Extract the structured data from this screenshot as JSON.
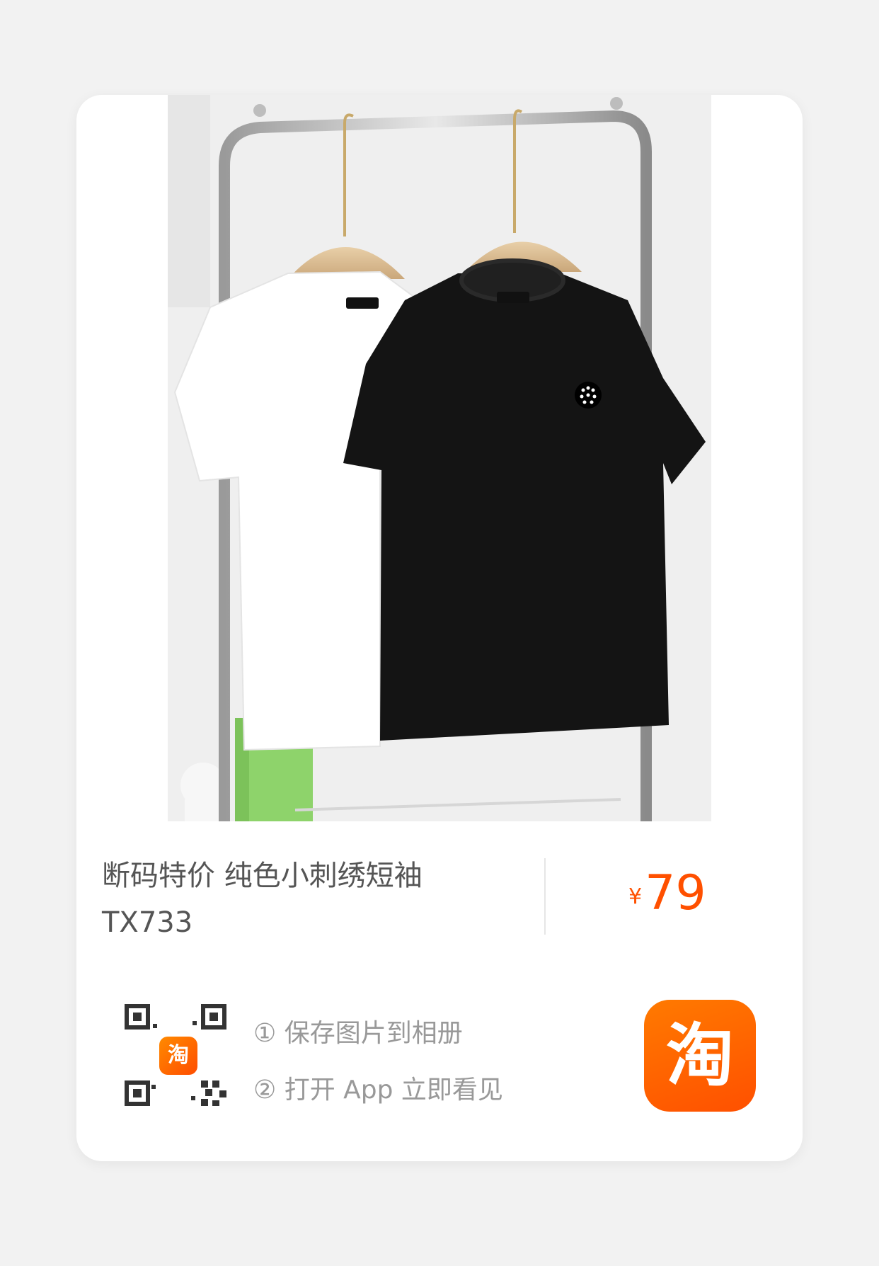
{
  "product": {
    "title": "断码特价 纯色小刺绣短袖TX733",
    "currency_symbol": "¥",
    "price": "79"
  },
  "share": {
    "qr_badge_text": "淘",
    "step1": "① 保存图片到相册",
    "step2": "② 打开 App 立即看见",
    "app_icon_text": "淘"
  },
  "colors": {
    "accent": "#ff5000",
    "background": "#f2f2f2",
    "card": "#ffffff"
  }
}
